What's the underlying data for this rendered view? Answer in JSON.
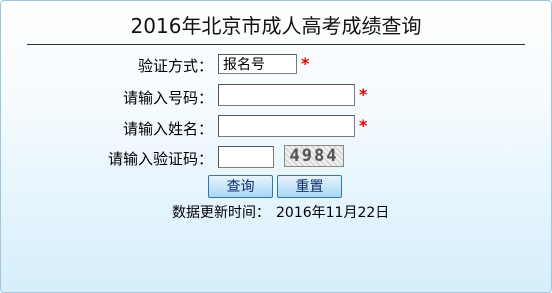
{
  "page": {
    "title": "2016年北京市成人高考成绩查询"
  },
  "form": {
    "mode_label": "验证方式：",
    "mode_value": "报名号",
    "number_label": "请输入号码：",
    "number_value": "",
    "name_label": "请输入姓名：",
    "name_value": "",
    "code_label": "请输入验证码：",
    "code_value": "",
    "captcha_text": "4984",
    "required_mark": "*"
  },
  "buttons": {
    "query": "查询",
    "reset": "重置"
  },
  "footer": {
    "update_label": "数据更新时间：",
    "update_date": "2016年11月22日"
  },
  "colors": {
    "required": "#e00000",
    "button_border": "#2d79b3",
    "panel_border": "#9ec6e0"
  }
}
